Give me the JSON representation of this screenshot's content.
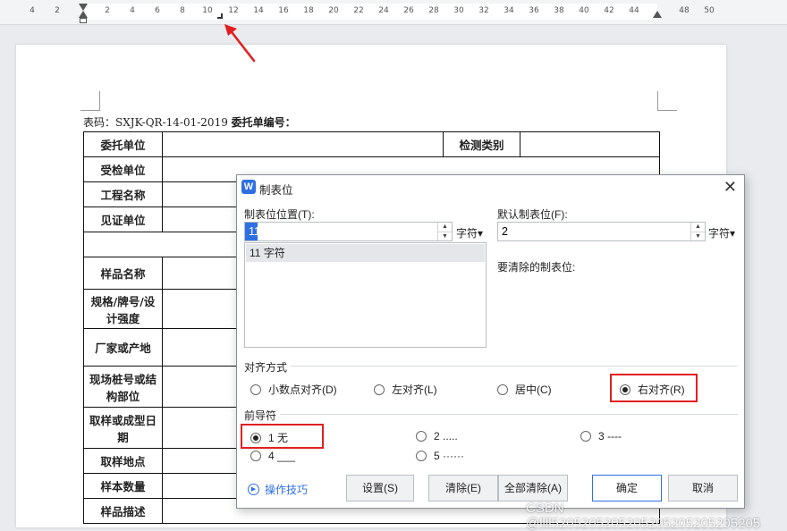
{
  "ruler": {
    "ticks": [
      "4",
      "2",
      "2",
      "4",
      "6",
      "8",
      "10",
      "12",
      "14",
      "16",
      "18",
      "20",
      "22",
      "24",
      "26",
      "28",
      "30",
      "32",
      "34",
      "36",
      "38",
      "40",
      "42",
      "44",
      "48",
      "50"
    ]
  },
  "document": {
    "form_code_prefix": "表码：SXJK-QR-14-01-2019",
    "form_code_suffix": "委托单编号：",
    "rows": [
      {
        "label": "委托单位",
        "extra_label": "检测类别"
      },
      {
        "label": "受检单位"
      },
      {
        "label": "工程名称"
      },
      {
        "label": "见证单位"
      },
      {
        "label": ""
      },
      {
        "label": "样品名称"
      },
      {
        "label": "规格/牌号/设计强度"
      },
      {
        "label": "厂家或产地"
      },
      {
        "label": "现场桩号或结构部位"
      },
      {
        "label": "取样或成型日期"
      },
      {
        "label": "取样地点"
      },
      {
        "label": "样本数量"
      },
      {
        "label": "样品描述"
      }
    ]
  },
  "dialog": {
    "title": "制表位",
    "tab_position_label": "制表位位置(T):",
    "tab_position_value": "11",
    "unit": "字符",
    "list_items": [
      "11 字符"
    ],
    "default_tab_label": "默认制表位(F):",
    "default_tab_value": "2",
    "clear_label": "要清除的制表位:",
    "align_group": "对齐方式",
    "align_options": [
      "小数点对齐(D)",
      "左对齐(L)",
      "居中(C)",
      "右对齐(R)"
    ],
    "align_selected": "右对齐(R)",
    "leader_group": "前导符",
    "leader_options": [
      "1 无",
      "2 .....",
      "3 ----",
      "4 ___",
      "5 ······"
    ],
    "leader_selected": "1 无",
    "tips": "操作技巧",
    "buttons": {
      "set": "设置(S)",
      "clear": "清除(E)",
      "clear_all": "全部清除(A)",
      "ok": "确定",
      "cancel": "取消"
    },
    "close_symbol": "✕"
  },
  "watermark": "CSDN @llll5205205205205205205205205205",
  "colors": {
    "accent": "#2f6fe4",
    "highlight": "#e02020",
    "arrow": "#e02020"
  }
}
